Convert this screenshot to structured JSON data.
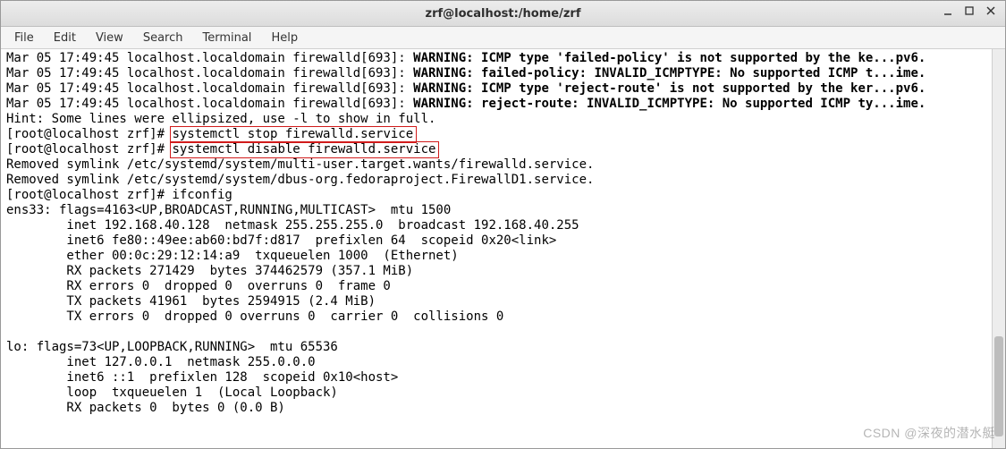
{
  "window": {
    "title": "zrf@localhost:/home/zrf"
  },
  "menu": {
    "file": "File",
    "edit": "Edit",
    "view": "View",
    "search": "Search",
    "terminal": "Terminal",
    "help": "Help"
  },
  "log": {
    "l1_prefix": "Mar 05 17:49:45 localhost.localdomain firewalld[693]: ",
    "l1_bold": "WARNING: ICMP type 'failed-policy' is not supported by the ke...pv6.",
    "l2_prefix": "Mar 05 17:49:45 localhost.localdomain firewalld[693]: ",
    "l2_bold": "WARNING: failed-policy: INVALID_ICMPTYPE: No supported ICMP t...ime.",
    "l3_prefix": "Mar 05 17:49:45 localhost.localdomain firewalld[693]: ",
    "l3_bold": "WARNING: ICMP type 'reject-route' is not supported by the ker...pv6.",
    "l4_prefix": "Mar 05 17:49:45 localhost.localdomain firewalld[693]: ",
    "l4_bold": "WARNING: reject-route: INVALID_ICMPTYPE: No supported ICMP ty...ime.",
    "hint": "Hint: Some lines were ellipsized, use -l to show in full.",
    "p1_prompt": "[root@localhost zrf]# ",
    "p1_cmd": "systemctl stop firewalld.service",
    "p2_prompt": "[root@localhost zrf]# ",
    "p2_cmd": "systemctl disable firewalld.service",
    "rm1": "Removed symlink /etc/systemd/system/multi-user.target.wants/firewalld.service.",
    "rm2": "Removed symlink /etc/systemd/system/dbus-org.fedoraproject.FirewallD1.service.",
    "p3": "[root@localhost zrf]# ifconfig",
    "if1": "ens33: flags=4163<UP,BROADCAST,RUNNING,MULTICAST>  mtu 1500",
    "if2": "        inet 192.168.40.128  netmask 255.255.255.0  broadcast 192.168.40.255",
    "if3": "        inet6 fe80::49ee:ab60:bd7f:d817  prefixlen 64  scopeid 0x20<link>",
    "if4": "        ether 00:0c:29:12:14:a9  txqueuelen 1000  (Ethernet)",
    "if5": "        RX packets 271429  bytes 374462579 (357.1 MiB)",
    "if6": "        RX errors 0  dropped 0  overruns 0  frame 0",
    "if7": "        TX packets 41961  bytes 2594915 (2.4 MiB)",
    "if8": "        TX errors 0  dropped 0 overruns 0  carrier 0  collisions 0",
    "blank": "",
    "lo1": "lo: flags=73<UP,LOOPBACK,RUNNING>  mtu 65536",
    "lo2": "        inet 127.0.0.1  netmask 255.0.0.0",
    "lo3": "        inet6 ::1  prefixlen 128  scopeid 0x10<host>",
    "lo4": "        loop  txqueuelen 1  (Local Loopback)",
    "lo5": "        RX packets 0  bytes 0 (0.0 B)"
  },
  "highlight": {
    "box1_cmd": "systemctl stop firewalld.service",
    "box2_cmd": "systemctl disable firewalld.service"
  },
  "watermark": "CSDN @深夜的潜水艇"
}
